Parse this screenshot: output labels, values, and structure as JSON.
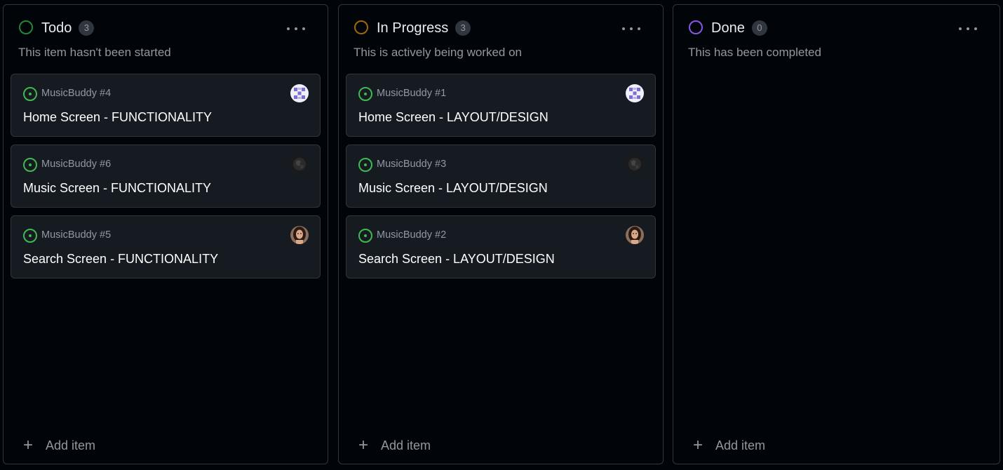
{
  "columns": [
    {
      "title": "Todo",
      "count": "3",
      "description": "This item hasn't been started",
      "status_color": "#238636",
      "add_label": "Add item",
      "cards": [
        {
          "ref": "MusicBuddy #4",
          "title": "Home Screen - FUNCTIONALITY",
          "avatar": "pixel-avatar"
        },
        {
          "ref": "MusicBuddy #6",
          "title": "Music Screen - FUNCTIONALITY",
          "avatar": "globe-avatar"
        },
        {
          "ref": "MusicBuddy #5",
          "title": "Search Screen - FUNCTIONALITY",
          "avatar": "person-avatar"
        }
      ]
    },
    {
      "title": "In Progress",
      "count": "3",
      "description": "This is actively being worked on",
      "status_color": "#9e6a03",
      "add_label": "Add item",
      "cards": [
        {
          "ref": "MusicBuddy #1",
          "title": "Home Screen - LAYOUT/DESIGN",
          "avatar": "pixel-avatar"
        },
        {
          "ref": "MusicBuddy #3",
          "title": "Music Screen - LAYOUT/DESIGN",
          "avatar": "globe-avatar"
        },
        {
          "ref": "MusicBuddy #2",
          "title": "Search Screen - LAYOUT/DESIGN",
          "avatar": "person-avatar"
        }
      ]
    },
    {
      "title": "Done",
      "count": "0",
      "description": "This has been completed",
      "status_color": "#8957e5",
      "add_label": "Add item",
      "cards": []
    }
  ],
  "colors": {
    "background": "#010409",
    "card": "#161b22",
    "border": "#30363d",
    "issue_open": "#3fb950",
    "muted_text": "#9198a1"
  }
}
